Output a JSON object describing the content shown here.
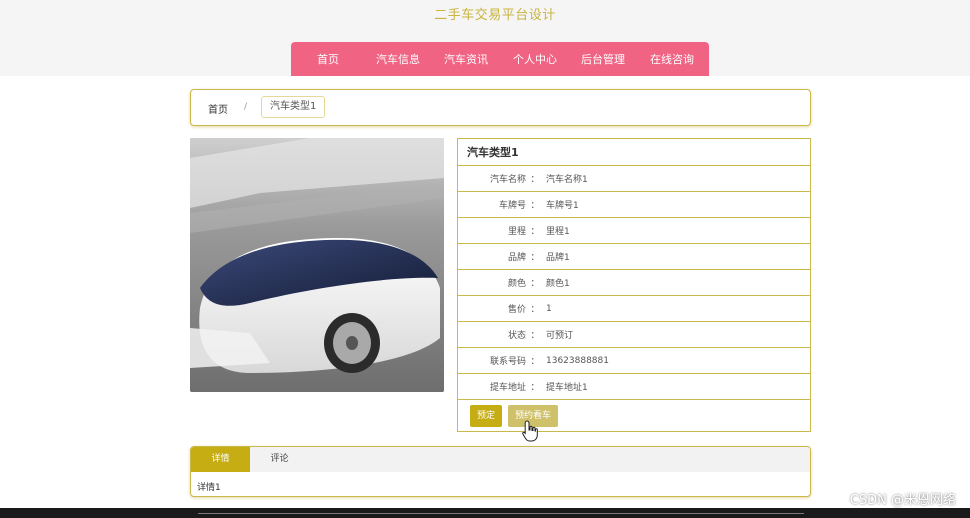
{
  "site": {
    "title": "二手车交易平台设计"
  },
  "nav": {
    "items": [
      {
        "label": "首页"
      },
      {
        "label": "汽车信息"
      },
      {
        "label": "汽车资讯"
      },
      {
        "label": "个人中心"
      },
      {
        "label": "后台管理"
      },
      {
        "label": "在线咨询"
      }
    ]
  },
  "breadcrumb": {
    "home": "首页",
    "separator": "/",
    "current": "汽车类型1"
  },
  "details": {
    "title": "汽车类型1",
    "colon": "：",
    "rows": [
      {
        "label": "汽车名称",
        "value": "汽车名称1"
      },
      {
        "label": "车牌号",
        "value": "车牌号1"
      },
      {
        "label": "里程",
        "value": "里程1"
      },
      {
        "label": "品牌",
        "value": "品牌1"
      },
      {
        "label": "颜色",
        "value": "颜色1"
      },
      {
        "label": "售价",
        "value": "1"
      },
      {
        "label": "状态",
        "value": "可预订"
      },
      {
        "label": "联系号码",
        "value": "13623888881"
      },
      {
        "label": "提车地址",
        "value": "提车地址1"
      }
    ]
  },
  "actions": {
    "book_label": "预定",
    "test_drive_label": "预约看车"
  },
  "tabs": {
    "items": [
      {
        "label": "详情"
      },
      {
        "label": "评论"
      }
    ],
    "active": 0,
    "content": "详情1"
  },
  "watermark": "CSDN @米恩网络",
  "colors": {
    "accent": "#c6ad14",
    "nav": "#f06383",
    "title": "#c9b43e",
    "border": "#c9b84a"
  }
}
